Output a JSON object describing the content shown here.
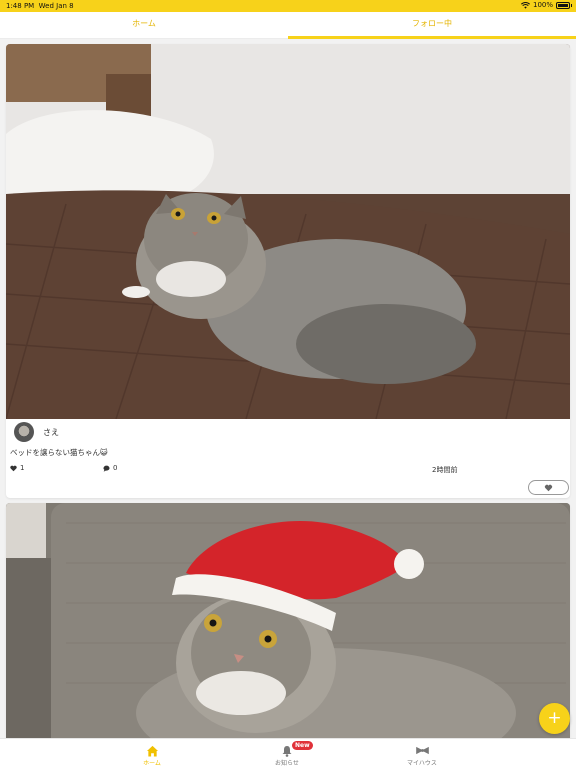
{
  "status_bar": {
    "time": "1:48 PM",
    "date": "Wed Jan 8",
    "battery": "100%"
  },
  "tabs": [
    {
      "label": "ホーム",
      "active": false
    },
    {
      "label": "フォロー中",
      "active": true
    }
  ],
  "posts": [
    {
      "photo_icon": "cat-photo",
      "author": "さえ",
      "caption": "ベッドを譲らない猫ちゃん😺",
      "likes": "1",
      "comments": "0",
      "time_ago": "2時間前"
    },
    {
      "photo_icon": "cat-santa-hat-photo"
    }
  ],
  "bottom_nav": [
    {
      "label": "ホーム",
      "icon": "home-icon",
      "active": true
    },
    {
      "label": "お知らせ",
      "icon": "bell-icon",
      "badge": "New"
    },
    {
      "label": "マイハウス",
      "icon": "bowtie-icon"
    }
  ],
  "fab": {
    "label": "+"
  },
  "colors": {
    "accent": "#f7d21a",
    "badge": "#e0323a"
  }
}
